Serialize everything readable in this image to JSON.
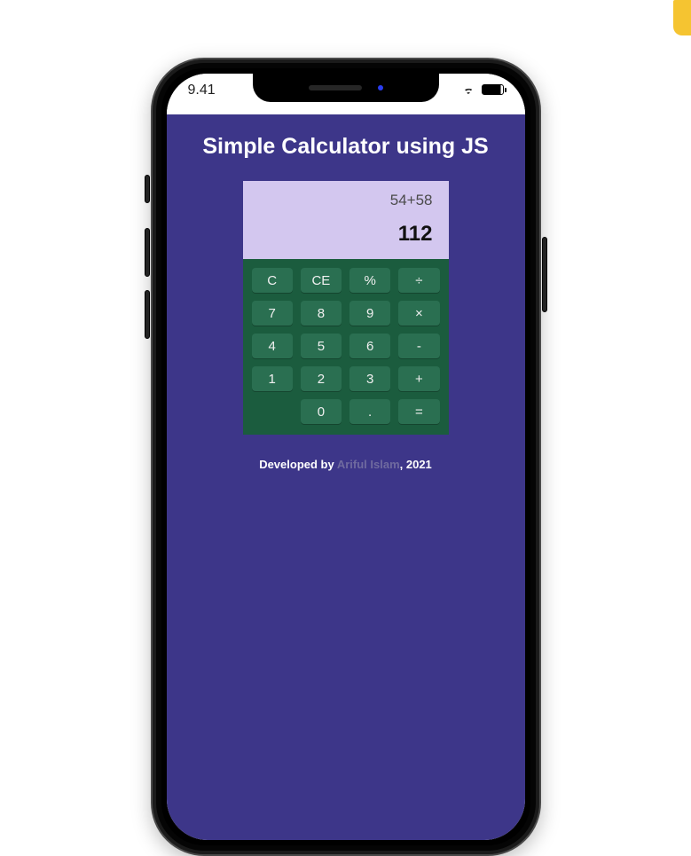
{
  "status": {
    "time": "9.41"
  },
  "app": {
    "title": "Simple Calculator using JS",
    "display": {
      "expression": "54+58",
      "result": "112"
    },
    "keys": [
      "C",
      "CE",
      "%",
      "÷",
      "7",
      "8",
      "9",
      "×",
      "4",
      "5",
      "6",
      "-",
      "1",
      "2",
      "3",
      "+",
      "",
      "0",
      ".",
      "="
    ],
    "footer": {
      "prefix": "Developed by ",
      "author": "Ariful Islam",
      "suffix": ", 2021"
    }
  }
}
